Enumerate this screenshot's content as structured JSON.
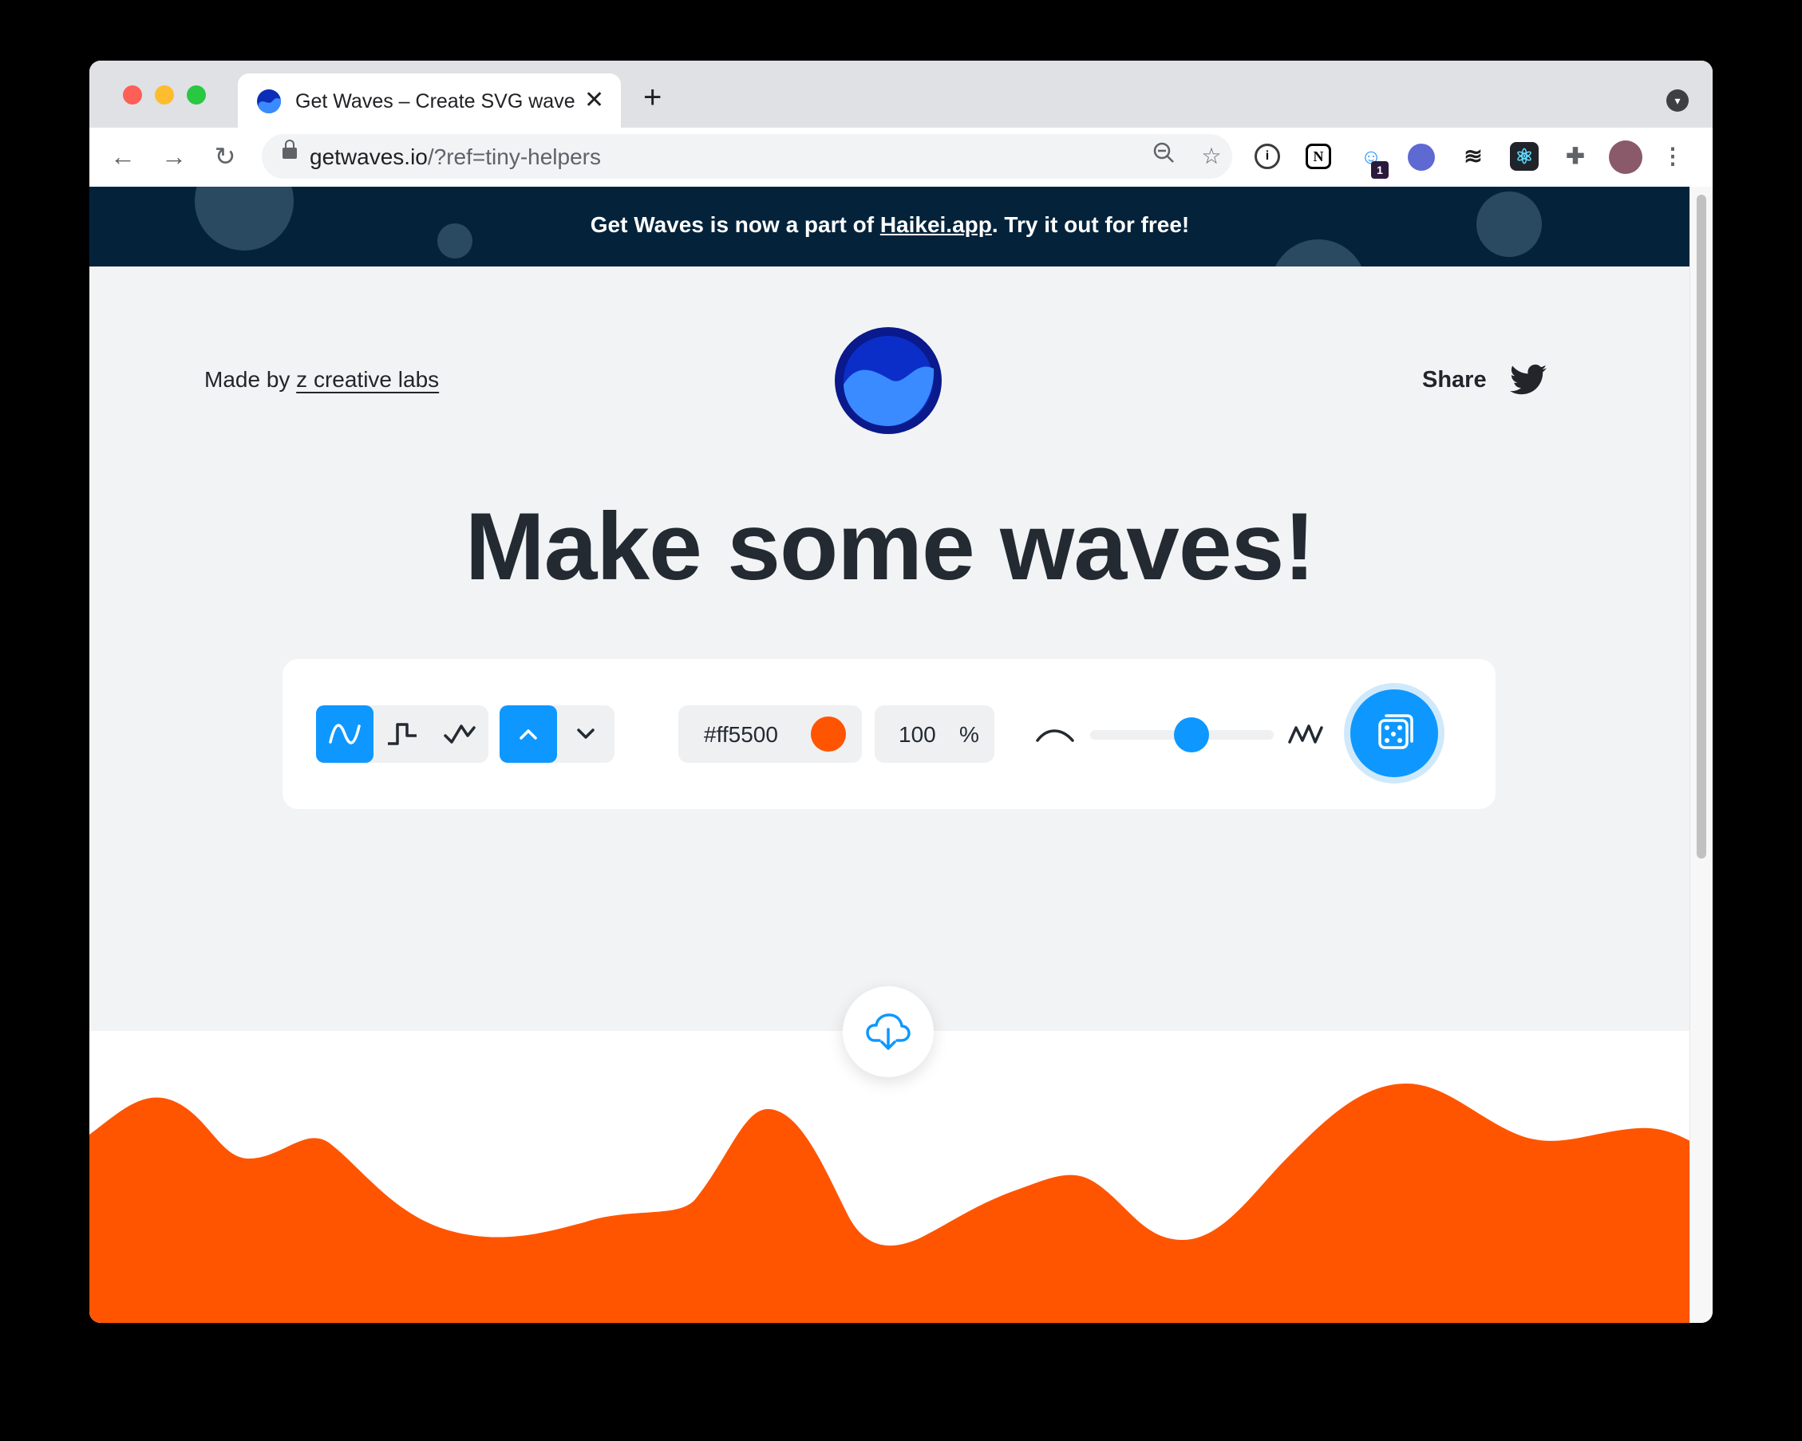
{
  "browser": {
    "tab": {
      "title": "Get Waves – Create SVG waves for your next design"
    },
    "url": {
      "host": "getwaves.io",
      "path": "/?ref=tiny-helpers"
    },
    "extensions": [
      {
        "icon": "onepassword-icon",
        "color": "#3b3b3b"
      },
      {
        "icon": "notion-icon",
        "color": "#000000"
      },
      {
        "icon": "ghost-extension-icon",
        "color": "#1e90ff",
        "badge": "1"
      },
      {
        "icon": "linear-icon",
        "color": "#5e6ad2"
      },
      {
        "icon": "buffer-icon",
        "color": "#231f20"
      },
      {
        "icon": "react-devtools-icon",
        "color": "#61dafb"
      },
      {
        "icon": "extensions-puzzle-icon",
        "color": "#5f6368"
      },
      {
        "icon": "profile-avatar",
        "color": "#8a5a6a"
      }
    ]
  },
  "banner": {
    "text_before": "Get Waves is now a part of ",
    "link": "Haikei.app",
    "text_after": ". Try it out for free!"
  },
  "header": {
    "made_by_prefix": "Made by ",
    "made_by_link": "z creative labs",
    "share_label": "Share"
  },
  "hero": {
    "title": "Make some waves!"
  },
  "controls": {
    "wave_types": [
      "smooth-wave",
      "step-wave",
      "peak-wave"
    ],
    "selected_wave_type": "smooth-wave",
    "directions": [
      "up",
      "down"
    ],
    "selected_direction": "up",
    "color_hex": "#ff5500",
    "opacity_value": "100",
    "opacity_unit": "%",
    "complexity_level": 0.55
  },
  "colors": {
    "accent": "#0e98ff",
    "wave": "#ff5500",
    "banner_bg": "#04233a",
    "page_bg": "#f2f3f5"
  }
}
